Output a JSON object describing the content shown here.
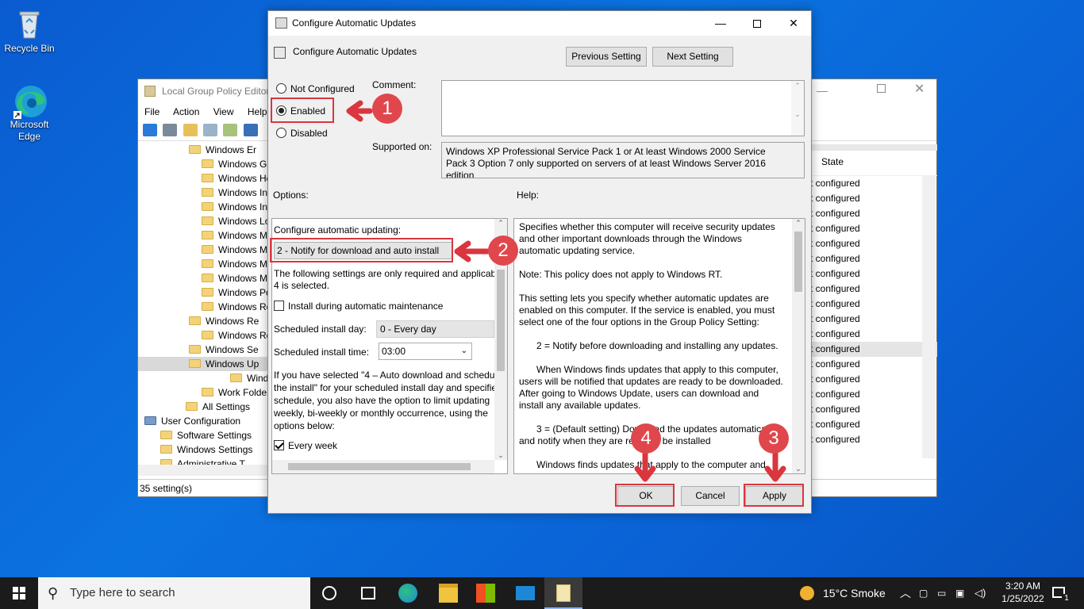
{
  "desktop": {
    "icons": [
      {
        "label": "Recycle Bin"
      },
      {
        "label": "Microsoft Edge"
      }
    ]
  },
  "gpe": {
    "title": "Local Group Policy Editor",
    "menu": [
      "File",
      "Action",
      "View",
      "Help"
    ],
    "tree": [
      {
        "label": "Windows Er",
        "chev": "›"
      },
      {
        "label": "Windows Ga",
        "chev": ""
      },
      {
        "label": "Windows He",
        "chev": ""
      },
      {
        "label": "Windows In",
        "chev": ""
      },
      {
        "label": "Windows In",
        "chev": ""
      },
      {
        "label": "Windows Lo",
        "chev": ""
      },
      {
        "label": "Windows M",
        "chev": ""
      },
      {
        "label": "Windows M",
        "chev": ""
      },
      {
        "label": "Windows M",
        "chev": ""
      },
      {
        "label": "Windows M",
        "chev": ""
      },
      {
        "label": "Windows Po",
        "chev": ""
      },
      {
        "label": "Windows Re",
        "chev": ""
      },
      {
        "label": "Windows Re",
        "chev": "›"
      },
      {
        "label": "Windows Re",
        "chev": ""
      },
      {
        "label": "Windows Se",
        "chev": "›"
      },
      {
        "label": "Windows Up",
        "chev": "⌄"
      },
      {
        "label": "Window",
        "chev": ""
      },
      {
        "label": "Work Folder",
        "chev": ""
      },
      {
        "label": "All Settings",
        "chev": ""
      },
      {
        "label": "User Configuration",
        "chev": "⌄"
      },
      {
        "label": "Software Settings",
        "chev": "›"
      },
      {
        "label": "Windows Settings",
        "chev": "›"
      },
      {
        "label": "Administrative T",
        "chev": "›"
      }
    ],
    "state_header": "State",
    "state_value": "t configured",
    "status": "35 setting(s)"
  },
  "dialog": {
    "title": "Configure Automatic Updates",
    "heading": "Configure Automatic Updates",
    "prev_button": "Previous Setting",
    "next_button": "Next Setting",
    "radio_not_configured": "Not Configured",
    "radio_enabled": "Enabled",
    "radio_disabled": "Disabled",
    "selected_radio": "Enabled",
    "comment_label": "Comment:",
    "comment_value": "",
    "supported_label": "Supported on:",
    "supported_value": "Windows XP Professional Service Pack 1 or At least Windows 2000 Service Pack 3 Option 7 only supported on servers of at least Windows Server 2016 edition",
    "options_label": "Options:",
    "help_label": "Help:",
    "options": {
      "configure_label": "Configure automatic updating:",
      "configure_value": "2 - Notify for download and auto install",
      "note1": "The following settings are only required and applicab",
      "note2": "4 is selected.",
      "maintenance_label": "Install during automatic maintenance",
      "maintenance_checked": false,
      "day_label": "Scheduled install day:",
      "day_value": "0 - Every day",
      "time_label": "Scheduled install time:",
      "time_value": "03:00",
      "para1": "If you have selected \"4 – Auto download and schedu",
      "para2": "the install\" for your scheduled install day and specifie",
      "para3": "schedule, you also have the option to limit updating",
      "para4": "weekly, bi-weekly or monthly occurrence, using the",
      "para5": "options below:",
      "every_week_label": "Every week",
      "every_week_checked": true
    },
    "help": {
      "p1": "Specifies whether this computer will receive security updates and other important downloads through the Windows automatic updating service.",
      "p2": "Note: This policy does not apply to Windows RT.",
      "p3": "This setting lets you specify whether automatic updates are enabled on this computer. If the service is enabled, you must select one of the four options in the Group Policy Setting:",
      "p4": "2 = Notify before downloading and installing any updates.",
      "p5": "When Windows finds updates that apply to this computer, users will be notified that updates are ready to be downloaded. After going to Windows Update, users can download and install any available updates.",
      "p6": "3 = (Default setting) Download the updates automatically and notify when they are ready to be installed",
      "p7": "Windows finds updates that apply to the computer and"
    },
    "ok_button": "OK",
    "cancel_button": "Cancel",
    "apply_button": "Apply"
  },
  "annotations": {
    "step1": "1",
    "step2": "2",
    "step3": "3",
    "step4": "4",
    "color": "#d9363e"
  },
  "taskbar": {
    "search_placeholder": "Type here to search",
    "weather": "15°C  Smoke",
    "time": "3:20 AM",
    "date": "1/25/2022",
    "notification_count": "1"
  }
}
